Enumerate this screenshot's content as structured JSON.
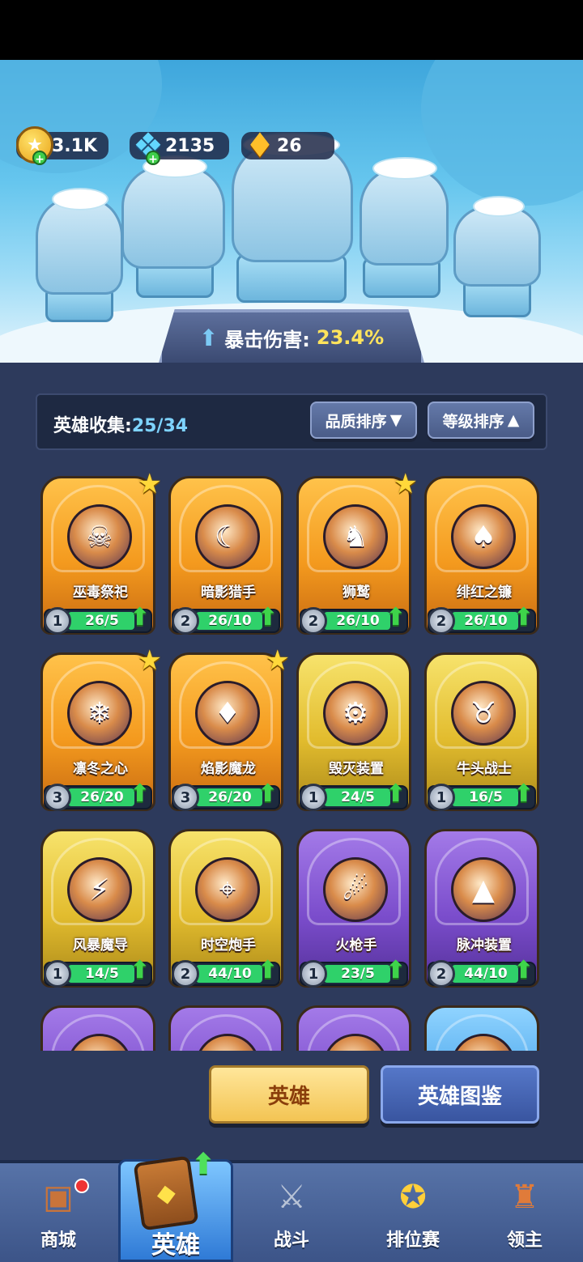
{
  "currencies": [
    {
      "name": "gold",
      "value": "3.1K",
      "icon": "gold-coin-icon"
    },
    {
      "name": "gems",
      "value": "2135",
      "icon": "blue-crystal-icon"
    },
    {
      "name": "shards",
      "value": "26",
      "icon": "gold-crystal-icon"
    }
  ],
  "bonus": {
    "label": "暴击伤害:",
    "value": "23.4%"
  },
  "collection": {
    "label": "英雄收集:",
    "count": "25/34"
  },
  "sort": {
    "quality": "品质排序",
    "level": "等级排序"
  },
  "heroes": [
    {
      "name": "巫毒祭祀",
      "level": "1",
      "progress": "26/5",
      "fill": 1.0,
      "rarity": "orange",
      "starred": true,
      "glyph": "☠"
    },
    {
      "name": "暗影猎手",
      "level": "2",
      "progress": "26/10",
      "fill": 1.0,
      "rarity": "orange",
      "starred": false,
      "glyph": "☾"
    },
    {
      "name": "狮鹫",
      "level": "2",
      "progress": "26/10",
      "fill": 1.0,
      "rarity": "orange",
      "starred": true,
      "glyph": "♞"
    },
    {
      "name": "绯红之镰",
      "level": "2",
      "progress": "26/10",
      "fill": 1.0,
      "rarity": "orange",
      "starred": false,
      "glyph": "♠"
    },
    {
      "name": "凛冬之心",
      "level": "3",
      "progress": "26/20",
      "fill": 1.0,
      "rarity": "orange",
      "starred": true,
      "glyph": "❄"
    },
    {
      "name": "焰影魔龙",
      "level": "3",
      "progress": "26/20",
      "fill": 1.0,
      "rarity": "orange",
      "starred": true,
      "glyph": "♦"
    },
    {
      "name": "毁灭装置",
      "level": "1",
      "progress": "24/5",
      "fill": 1.0,
      "rarity": "gold",
      "starred": false,
      "glyph": "⚙"
    },
    {
      "name": "牛头战士",
      "level": "1",
      "progress": "16/5",
      "fill": 1.0,
      "rarity": "gold",
      "starred": false,
      "glyph": "♉"
    },
    {
      "name": "风暴魔导",
      "level": "1",
      "progress": "14/5",
      "fill": 1.0,
      "rarity": "gold",
      "starred": false,
      "glyph": "⚡"
    },
    {
      "name": "时空炮手",
      "level": "2",
      "progress": "44/10",
      "fill": 1.0,
      "rarity": "gold",
      "starred": false,
      "glyph": "⌖"
    },
    {
      "name": "火枪手",
      "level": "1",
      "progress": "23/5",
      "fill": 1.0,
      "rarity": "purple",
      "starred": false,
      "glyph": "☄"
    },
    {
      "name": "脉冲装置",
      "level": "2",
      "progress": "44/10",
      "fill": 1.0,
      "rarity": "purple",
      "starred": false,
      "glyph": "▲"
    },
    {
      "rarity": "purple"
    },
    {
      "rarity": "purple"
    },
    {
      "rarity": "purple"
    },
    {
      "rarity": "blue"
    }
  ],
  "tabs": {
    "heroes": "英雄",
    "codex": "英雄图鉴"
  },
  "nav": {
    "shop": "商城",
    "heroes": "英雄",
    "battle": "战斗",
    "ranked": "排位赛",
    "lord": "领主"
  }
}
